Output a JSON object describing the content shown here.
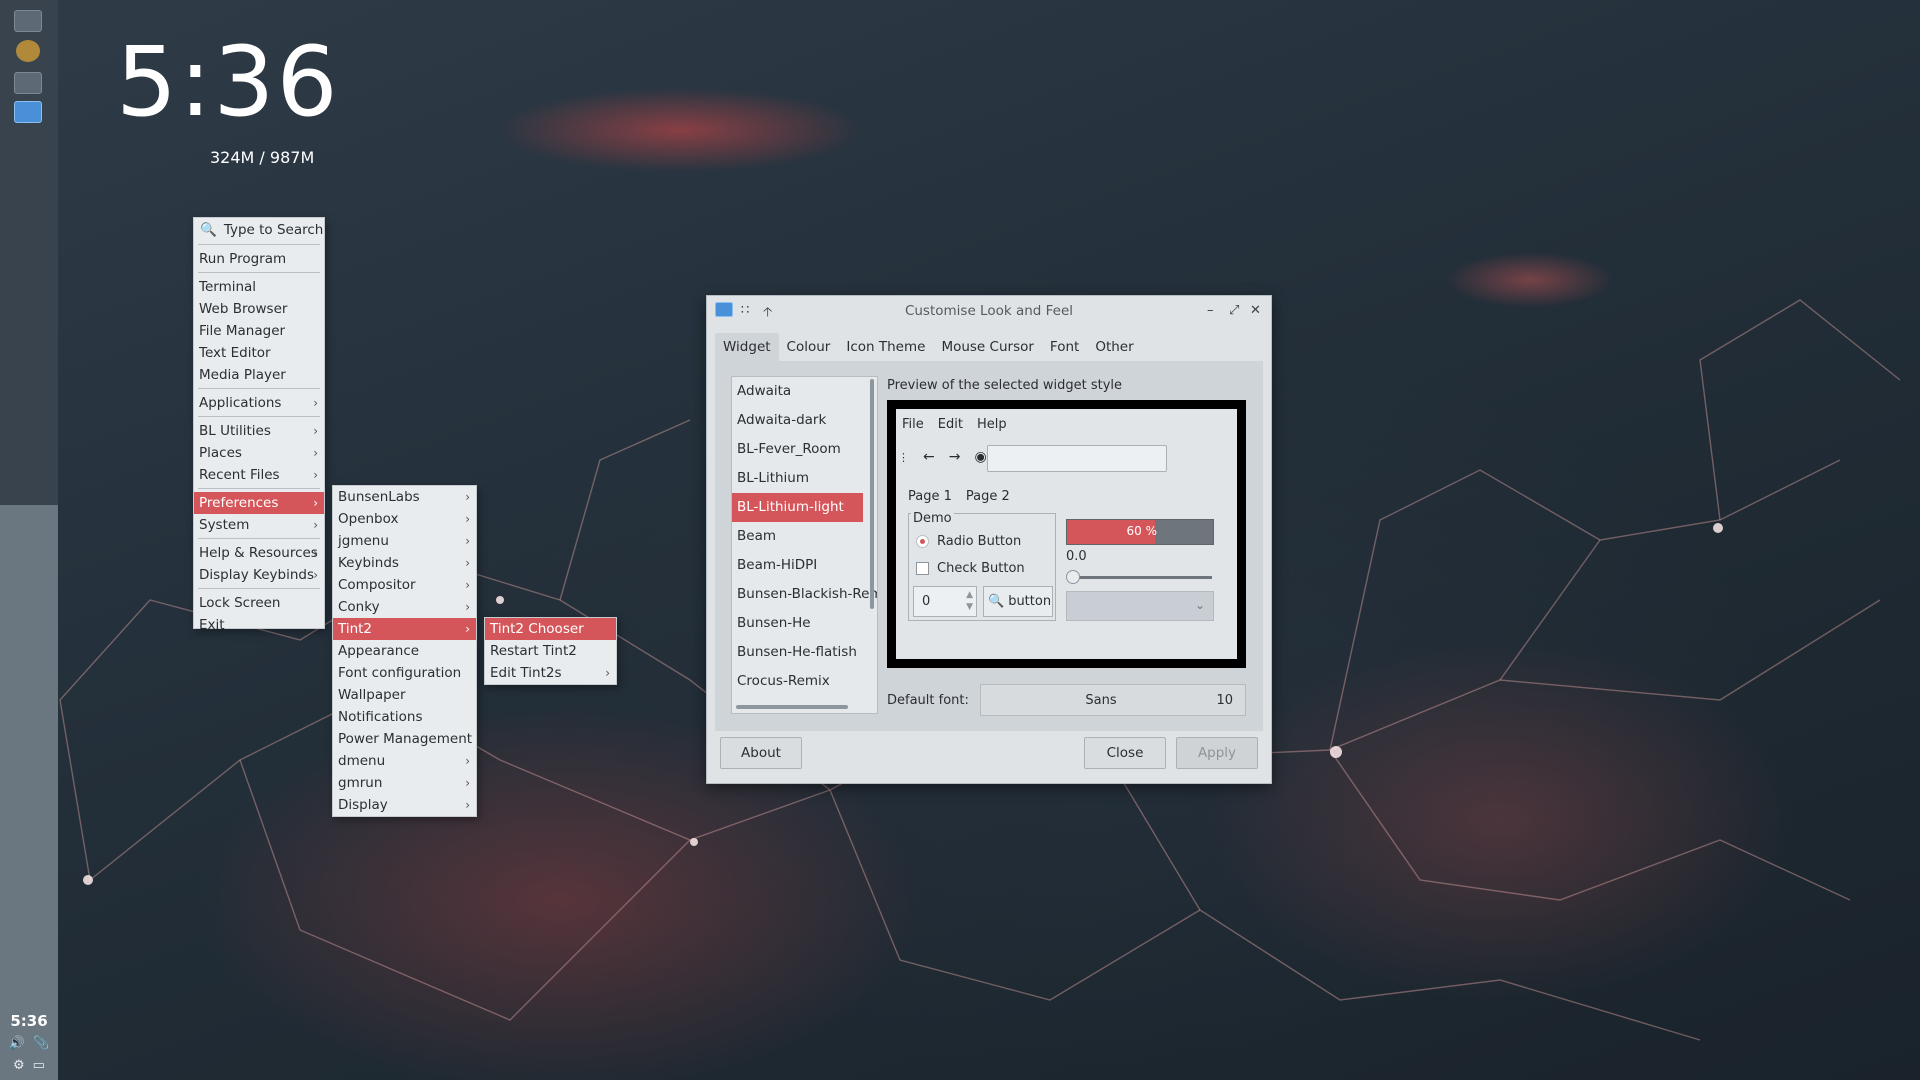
{
  "desktop": {
    "clock": "5:36",
    "memory": "324M / 987M"
  },
  "dock": {
    "clock": "5:36",
    "icons": [
      "folder-icon",
      "package-icon",
      "folder-icon",
      "window-icon"
    ],
    "tray_icons": [
      "volume-icon",
      "attachment-icon",
      "settings-icon",
      "display-icon"
    ]
  },
  "root_menu": {
    "search_placeholder": "Type to Search",
    "items": {
      "run_program": "Run Program",
      "terminal": "Terminal",
      "web_browser": "Web Browser",
      "file_manager": "File Manager",
      "text_editor": "Text Editor",
      "media_player": "Media Player",
      "applications": "Applications",
      "bl_utilities": "BL Utilities",
      "places": "Places",
      "recent_files": "Recent Files",
      "preferences": "Preferences",
      "system": "System",
      "help_resources": "Help & Resources",
      "display_keybinds": "Display Keybinds",
      "lock_screen": "Lock Screen",
      "exit": "Exit"
    }
  },
  "preferences_menu": {
    "items": {
      "bunsenlabs": "BunsenLabs",
      "openbox": "Openbox",
      "jgmenu": "jgmenu",
      "keybinds": "Keybinds",
      "compositor": "Compositor",
      "conky": "Conky",
      "tint2": "Tint2",
      "appearance": "Appearance",
      "font_configuration": "Font configuration",
      "wallpaper": "Wallpaper",
      "notifications": "Notifications",
      "power_management": "Power Management",
      "dmenu": "dmenu",
      "gmrun": "gmrun",
      "display": "Display"
    }
  },
  "tint2_menu": {
    "items": {
      "tint2_chooser": "Tint2 Chooser",
      "restart_tint2": "Restart Tint2",
      "edit_tint2s": "Edit Tint2s"
    }
  },
  "dialog": {
    "title": "Customise Look and Feel",
    "tabs": {
      "widget": "Widget",
      "colour": "Colour",
      "icon_theme": "Icon Theme",
      "mouse_cursor": "Mouse Cursor",
      "font": "Font",
      "other": "Other"
    },
    "themes": {
      "t0": "Adwaita",
      "t1": "Adwaita-dark",
      "t2": "BL-Fever_Room",
      "t3": "BL-Lithium",
      "t4": "BL-Lithium-light",
      "t5": "Beam",
      "t6": "Beam-HiDPI",
      "t7": "Bunsen-Blackish-Remix",
      "t8": "Bunsen-He",
      "t9": "Bunsen-He-flatish",
      "t10": "Crocus-Remix"
    },
    "selected_theme": "BL-Lithium-light",
    "preview_label": "Preview of the selected widget style",
    "preview": {
      "menu_file": "File",
      "menu_edit": "Edit",
      "menu_help": "Help",
      "page1": "Page 1",
      "page2": "Page 2",
      "demo": "Demo",
      "radio": "Radio Button",
      "check": "Check Button",
      "spin_value": "0",
      "button_label": "button",
      "progress_text": "60 %",
      "progress_value": 0.6,
      "scale_value": "0.0"
    },
    "default_font_label": "Default font:",
    "font_name": "Sans",
    "font_size": "10",
    "about_button": "About",
    "close_button": "Close",
    "apply_button": "Apply"
  },
  "colors": {
    "accent": "#d5565a",
    "menu_bg": "#e9ecee",
    "dialog_bg": "#dfe3e6"
  }
}
